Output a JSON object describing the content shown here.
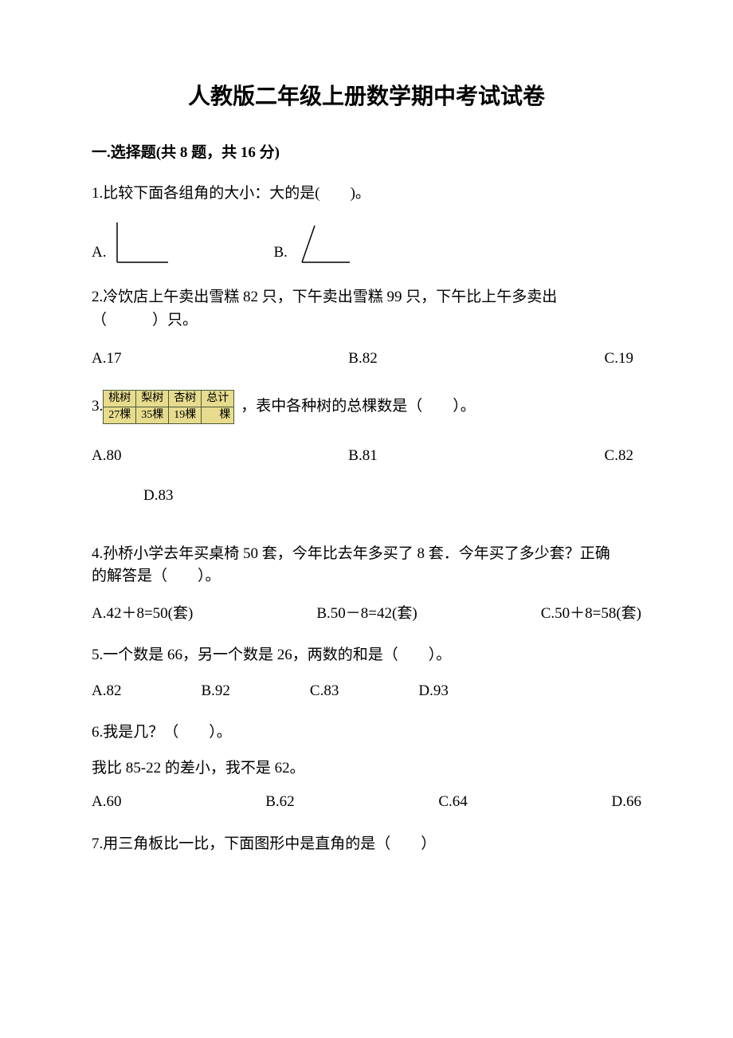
{
  "title": "人教版二年级上册数学期中考试试卷",
  "section1": {
    "heading": "一.选择题(共 8 题，共 16 分)"
  },
  "q1": {
    "text": "1.比较下面各组角的大小：大的是(　　)。",
    "labelA": "A.",
    "labelB": "B."
  },
  "q2": {
    "line1": "2.冷饮店上午卖出雪糕 82 只，下午卖出雪糕 99 只，下午比上午多卖出",
    "line2": "（　　　）只。",
    "A": "A.17",
    "B": "B.82",
    "C": "C.19"
  },
  "q3": {
    "prefix": "3.",
    "table": {
      "h1": "桃树",
      "h2": "梨树",
      "h3": "杏树",
      "h4": "总计",
      "r1": "27棵",
      "r2": "35棵",
      "r3": "19棵",
      "r4": "棵"
    },
    "suffix": "，表中各种树的总棵数是（　　）。",
    "A": "A.80",
    "B": "B.81",
    "C": "C.82",
    "D": "D.83"
  },
  "q4": {
    "line1": "4.孙桥小学去年买桌椅 50 套，今年比去年多买了 8 套．今年买了多少套？正确",
    "line2": "的解答是（　　）。",
    "A": "A.42＋8=50(套)",
    "B": "B.50－8=42(套)",
    "C": "C.50＋8=58(套)"
  },
  "q5": {
    "text": "5.一个数是 66，另一个数是 26，两数的和是（　　）。",
    "A": "A.82",
    "B": "B.92",
    "C": "C.83",
    "D": "D.93"
  },
  "q6": {
    "text": "6.我是几？（　　）。",
    "sub": "我比 85-22 的差小，我不是 62。",
    "A": "A.60",
    "B": "B.62",
    "C": "C.64",
    "D": "D.66"
  },
  "q7": {
    "text": "7.用三角板比一比，下面图形中是直角的是（　　）"
  }
}
